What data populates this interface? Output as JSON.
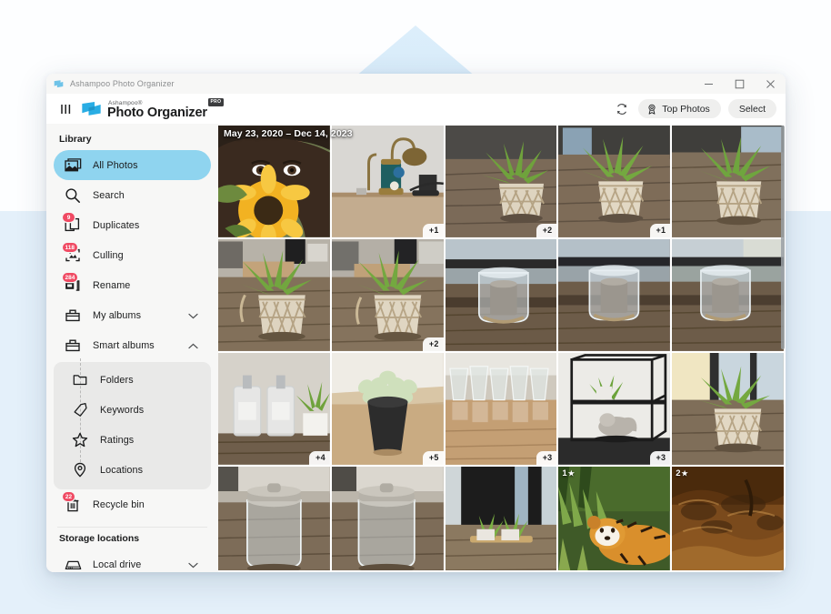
{
  "window": {
    "title": "Ashampoo Photo Organizer",
    "controls": {
      "minimize": "minimize-icon",
      "maximize": "maximize-icon",
      "close": "close-icon"
    }
  },
  "brand": {
    "superscript": "Ashampoo®",
    "name": "Photo Organizer",
    "edition": "PRO"
  },
  "toolbar": {
    "refresh_icon": "refresh-icon",
    "top_photos_label": "Top Photos",
    "top_photos_icon": "award-icon",
    "select_label": "Select"
  },
  "sidebar": {
    "library_title": "Library",
    "items": [
      {
        "label": "All Photos",
        "icon": "photos-icon",
        "selected": true,
        "badge": null,
        "chevron": null
      },
      {
        "label": "Search",
        "icon": "search-icon",
        "selected": false,
        "badge": null,
        "chevron": null
      },
      {
        "label": "Duplicates",
        "icon": "duplicates-icon",
        "selected": false,
        "badge": "9",
        "chevron": null
      },
      {
        "label": "Culling",
        "icon": "culling-icon",
        "selected": false,
        "badge": "118",
        "chevron": null
      },
      {
        "label": "Rename",
        "icon": "rename-icon",
        "selected": false,
        "badge": "284",
        "chevron": null
      },
      {
        "label": "My albums",
        "icon": "album-icon",
        "selected": false,
        "badge": null,
        "chevron": "down"
      },
      {
        "label": "Smart albums",
        "icon": "album-icon",
        "selected": false,
        "badge": null,
        "chevron": "up"
      }
    ],
    "smart_albums": [
      {
        "label": "Folders",
        "icon": "folder-icon"
      },
      {
        "label": "Keywords",
        "icon": "tag-icon"
      },
      {
        "label": "Ratings",
        "icon": "star-icon"
      },
      {
        "label": "Locations",
        "icon": "pin-icon"
      }
    ],
    "recycle_bin": {
      "label": "Recycle bin",
      "icon": "trash-icon",
      "badge": "22"
    },
    "storage_title": "Storage locations",
    "storage_items": [
      {
        "label": "Local drive",
        "icon": "drive-icon",
        "chevron": "down"
      }
    ]
  },
  "grid": {
    "date_range": "May 23, 2020 – Dec 14, 2023",
    "tiles": [
      {
        "name": "woman-with-sunflower",
        "count": null,
        "rating": null
      },
      {
        "name": "brass-lamp-on-floor",
        "count": "+1",
        "rating": null
      },
      {
        "name": "plant-in-rope-basket-a",
        "count": "+2",
        "rating": null
      },
      {
        "name": "plant-in-rope-basket-b",
        "count": "+1",
        "rating": null
      },
      {
        "name": "plant-in-rope-basket-c",
        "count": null,
        "rating": null
      },
      {
        "name": "plant-on-wood-table-a",
        "count": null,
        "rating": null
      },
      {
        "name": "plant-on-wood-table-b",
        "count": "+2",
        "rating": null
      },
      {
        "name": "glass-jar-candle-a",
        "count": null,
        "rating": null
      },
      {
        "name": "glass-jar-candle-b",
        "count": null,
        "rating": null
      },
      {
        "name": "glass-jar-candle-c",
        "count": null,
        "rating": null
      },
      {
        "name": "soap-dispensers-and-plant",
        "count": "+4",
        "rating": null
      },
      {
        "name": "succulent-in-black-pot",
        "count": "+5",
        "rating": null
      },
      {
        "name": "stacked-glasses-on-table",
        "count": "+3",
        "rating": null
      },
      {
        "name": "wire-shelf-with-figurine",
        "count": "+3",
        "rating": null
      },
      {
        "name": "plant-basket-by-window",
        "count": null,
        "rating": null
      },
      {
        "name": "glass-canister-a",
        "count": null,
        "rating": null
      },
      {
        "name": "glass-canister-b",
        "count": null,
        "rating": null
      },
      {
        "name": "planters-on-window-sill",
        "count": null,
        "rating": null
      },
      {
        "name": "tiger-in-grass",
        "count": null,
        "rating": "1"
      },
      {
        "name": "rock-cave-texture",
        "count": null,
        "rating": "2"
      }
    ],
    "rating_star": "★"
  },
  "colors": {
    "accent": "#8fd4ef",
    "badge": "#f04a63",
    "sidebar_bg": "#f7f7f6",
    "panel_bg": "#e9e9e8",
    "backdrop_blue": "#e4f0fa"
  }
}
